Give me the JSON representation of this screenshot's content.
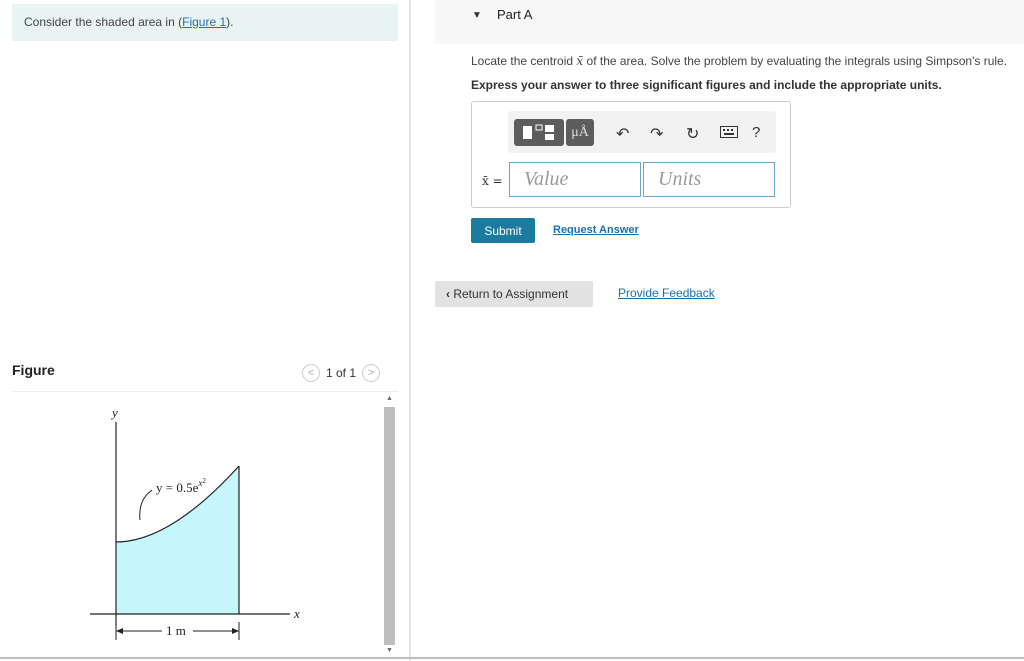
{
  "prompt": {
    "text": "Consider the shaded area in (",
    "link": "Figure 1",
    "suffix": ")."
  },
  "figure": {
    "header": "Figure",
    "pager_text": "1 of 1",
    "y_axis_label": "y",
    "x_axis_label": "x",
    "curve_label": "y = 0.5e",
    "curve_exp": "x",
    "curve_exp2": "2",
    "dimension_label": "1 m",
    "fill_color": "#c4f6fb"
  },
  "part": {
    "title": "Part A",
    "question_prefix": "Locate the centroid ",
    "question_symbol": "x̄",
    "question_suffix": " of the area. Solve the problem by evaluating the integrals using Simpson's rule.",
    "instruction": "Express your answer to three significant figures and include the appropriate units.",
    "toolbar": {
      "mu_label": "μÅ",
      "help_label": "?"
    },
    "answer_label": "x̄ =",
    "value_placeholder": "Value",
    "units_placeholder": "Units",
    "submit_label": "Submit",
    "request_label": "Request Answer"
  },
  "nav": {
    "return_label": "Return to Assignment",
    "feedback_label": "Provide Feedback"
  }
}
